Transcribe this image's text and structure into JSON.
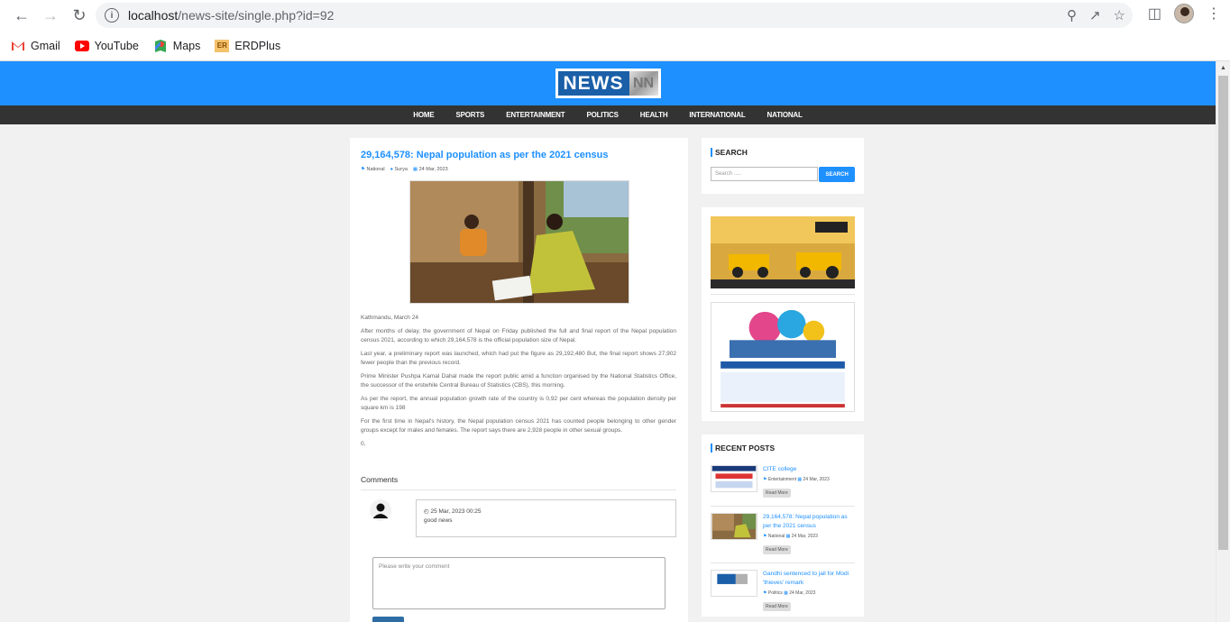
{
  "browser": {
    "url_host": "localhost",
    "url_path": "/news-site/single.php?id=92",
    "bookmarks": [
      {
        "label": "Gmail",
        "icon": "gmail-icon"
      },
      {
        "label": "YouTube",
        "icon": "youtube-icon"
      },
      {
        "label": "Maps",
        "icon": "maps-icon"
      },
      {
        "label": "ERDPlus",
        "icon": "erdplus-icon"
      }
    ]
  },
  "site": {
    "logo_text": "NEWS",
    "logo_mark": "NN",
    "brand_color": "#1e90ff",
    "menu": [
      "HOME",
      "SPORTS",
      "ENTERTAINMENT",
      "POLITICS",
      "HEALTH",
      "INTERNATIONAL",
      "NATIONAL"
    ]
  },
  "post": {
    "title": "29,164,578: Nepal population as per the 2021 census",
    "category": "National",
    "author": "Surya",
    "date": "24 Mar, 2023",
    "paragraphs": [
      "Kathmandu, March 24",
      "After months of delay, the government of Nepal on Friday published the full and final report of the Nepal population census 2021, according to which 29,164,578 is the official population size of Nepal.",
      "Last year, a preliminary report was launched, which had put the figure as 29,192,480 But, the final report shows 27,902 fewer people than the previous record.",
      "Prime Minister Pushpa Kamal Dahal made the report public amid a function organised by the National Statistics Office, the successor of the erstwhile Central Bureau of Statistics (CBS), this morning.",
      "As per the report, the annual population growth rate of the country is 0,92 per cent whereas the population density per square km is 198",
      "For the first time in Nepal's history, the Nepal population census 2021 has counted people belonging to other gender groups except for males and females. The report says there are 2,928 people in other sexual groups.",
      "0,"
    ]
  },
  "comments": {
    "heading": "Comments",
    "items": [
      {
        "date": "25 Mar, 2023 00:25",
        "text": "good news"
      }
    ],
    "placeholder": "Please write your comment"
  },
  "sidebar": {
    "search_heading": "SEARCH",
    "search_placeholder": "Search .....",
    "search_button": "SEARCH",
    "recent_heading": "RECENT POSTS",
    "recent": [
      {
        "title": "CITE college",
        "category": "Entertainment",
        "date": "24 Mar, 2023",
        "more": "Read More"
      },
      {
        "title": "29,164,578: Nepal population as per the 2021 census",
        "category": "National",
        "date": "24 Mar, 2023",
        "more": "Read More"
      },
      {
        "title": "Gandhi sentenced to jail for Modi 'thieves' remark",
        "category": "Politics",
        "date": "24 Mar, 2023",
        "more": "Read More"
      }
    ]
  }
}
